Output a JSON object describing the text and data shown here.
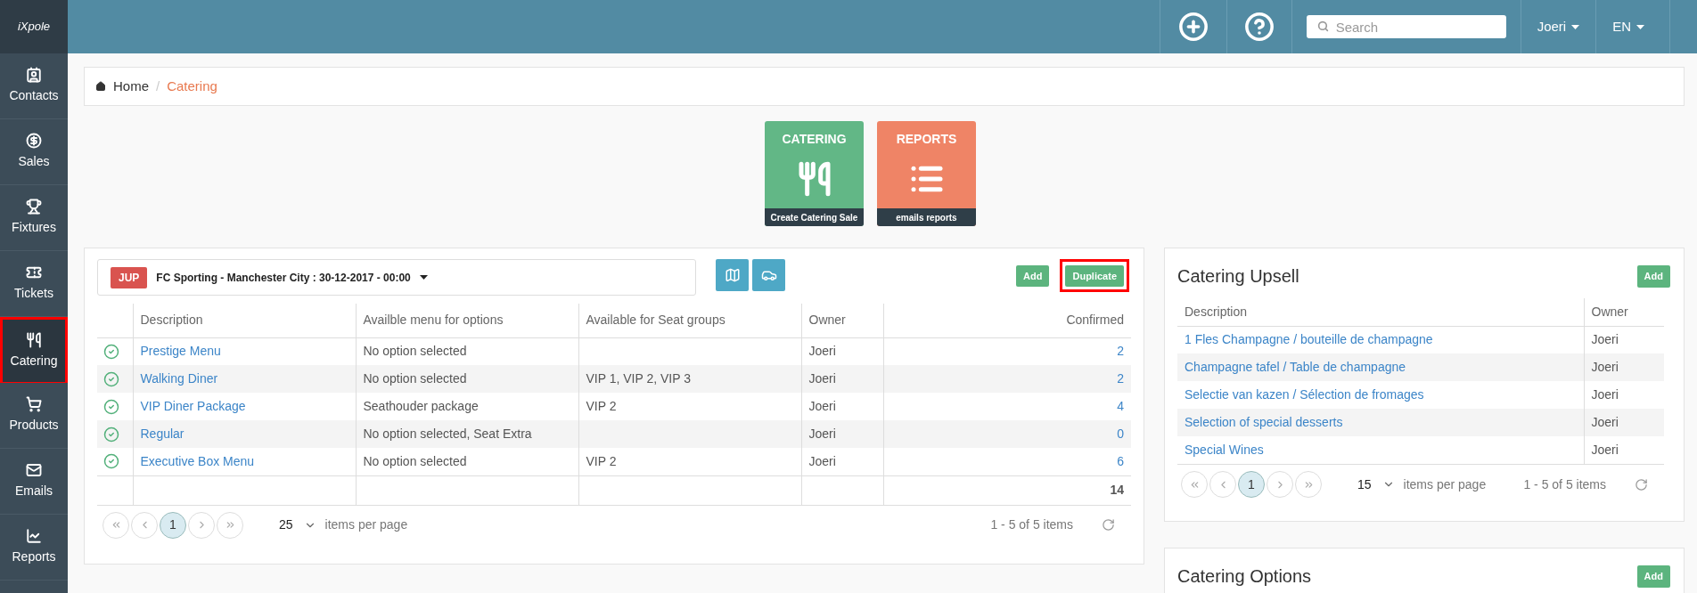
{
  "topbar": {
    "search": {
      "placeholder": "Search"
    },
    "user": "Joeri",
    "language": "EN"
  },
  "sidebar": {
    "logo": "iXpole",
    "items": [
      {
        "label": "Contacts",
        "selected": false,
        "annotated": false
      },
      {
        "label": "Sales",
        "selected": false,
        "annotated": false
      },
      {
        "label": "Fixtures",
        "selected": false,
        "annotated": false
      },
      {
        "label": "Tickets",
        "selected": false,
        "annotated": false
      },
      {
        "label": "Catering",
        "selected": true,
        "annotated": true
      },
      {
        "label": "Products",
        "selected": false,
        "annotated": false
      },
      {
        "label": "Emails",
        "selected": false,
        "annotated": false
      },
      {
        "label": "Reports",
        "selected": false,
        "annotated": false
      }
    ]
  },
  "breadcrumb_separator": "/",
  "breadcrumb": [
    {
      "label": "Home",
      "current": false
    },
    {
      "label": "Catering",
      "current": true
    }
  ],
  "tiles": [
    {
      "kind": "catering",
      "title": "CATERING",
      "caption": "Create Catering Sale"
    },
    {
      "kind": "reports",
      "title": "REPORTS",
      "caption": "emails reports"
    }
  ],
  "menus_panel": {
    "event": {
      "badge": "JUP",
      "label": "FC Sporting - Manchester City : 30-12-2017 - 00:00"
    },
    "buttons": [
      {
        "label": "Add",
        "annotated": false
      },
      {
        "label": "Duplicate",
        "annotated": true
      }
    ],
    "table": {
      "columns": [
        "Description",
        "Availble menu for options",
        "Available for Seat groups",
        "Owner",
        "Confirmed"
      ],
      "rows": [
        {
          "active": true,
          "description": "Prestige Menu",
          "menu_options": "No option selected",
          "seat_groups": "",
          "owner": "Joeri",
          "confirmed": "2"
        },
        {
          "active": true,
          "description": "Walking Diner",
          "menu_options": "No option selected",
          "seat_groups": "VIP 1, VIP 2, VIP 3",
          "owner": "Joeri",
          "confirmed": "2"
        },
        {
          "active": true,
          "description": "VIP Diner Package",
          "menu_options": "Seathouder package",
          "seat_groups": "VIP 2",
          "owner": "Joeri",
          "confirmed": "4"
        },
        {
          "active": true,
          "description": "Regular",
          "menu_options": "No option selected, Seat Extra",
          "seat_groups": "",
          "owner": "Joeri",
          "confirmed": "0"
        },
        {
          "active": true,
          "description": "Executive Box Menu",
          "menu_options": "No option selected",
          "seat_groups": "VIP 2",
          "owner": "Joeri",
          "confirmed": "6"
        }
      ],
      "total": "14"
    },
    "pager": {
      "pages": [
        {
          "label": "1",
          "selected": true
        }
      ],
      "page_size": "25",
      "page_size_label": "items per page",
      "summary": "1 - 5 of 5 items"
    }
  },
  "upsell_panel": {
    "title": "Catering Upsell",
    "add_button": "Add",
    "table": {
      "columns": [
        "Description",
        "Owner"
      ],
      "rows": [
        {
          "description": "1 Fles Champagne / bouteille de champagne",
          "owner": "Joeri"
        },
        {
          "description": "Champagne tafel / Table de champagne",
          "owner": "Joeri"
        },
        {
          "description": "Selectie van kazen / Sélection de fromages",
          "owner": "Joeri"
        },
        {
          "description": "Selection of special desserts",
          "owner": "Joeri"
        },
        {
          "description": "Special Wines",
          "owner": "Joeri"
        }
      ]
    },
    "pager": {
      "pages": [
        {
          "label": "1",
          "selected": true
        }
      ],
      "page_size": "15",
      "page_size_label": "items per page",
      "summary": "1 - 5 of 5 items"
    }
  },
  "options_panel": {
    "title": "Catering Options",
    "add_button": "Add"
  }
}
